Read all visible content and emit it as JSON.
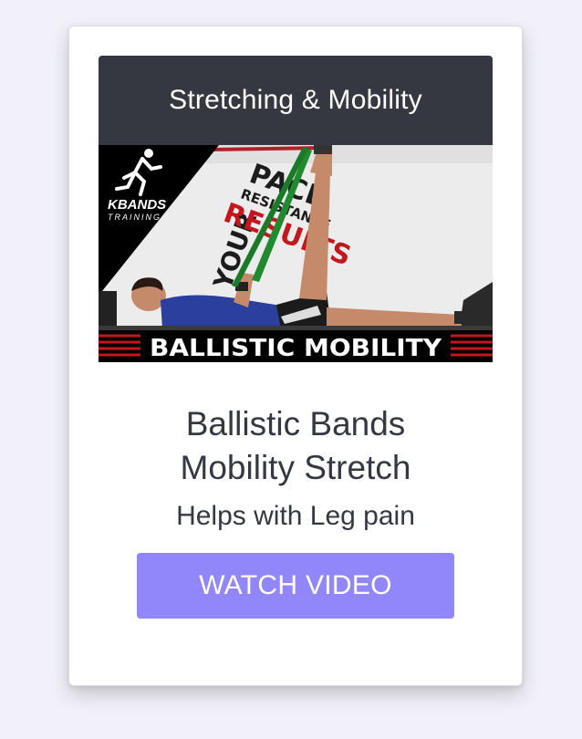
{
  "card": {
    "category": "Stretching & Mobility",
    "thumbnail": {
      "logo_text": "KBANDS",
      "logo_subtext": "TRAINING",
      "banner_text": "BALLISTIC MOBILITY",
      "wall_line1": "YOUR",
      "wall_line2": "PACE",
      "wall_line3": "RESISTANCE",
      "wall_line4": "RESULTS"
    },
    "title_line1": "Ballistic Bands",
    "title_line2": "Mobility Stretch",
    "subtitle": "Helps with Leg pain",
    "button_label": "WATCH VIDEO"
  },
  "colors": {
    "page_background": "#f2f1f9",
    "header_background": "#353840",
    "button_background": "#9286fb",
    "text_dark": "#353840"
  }
}
